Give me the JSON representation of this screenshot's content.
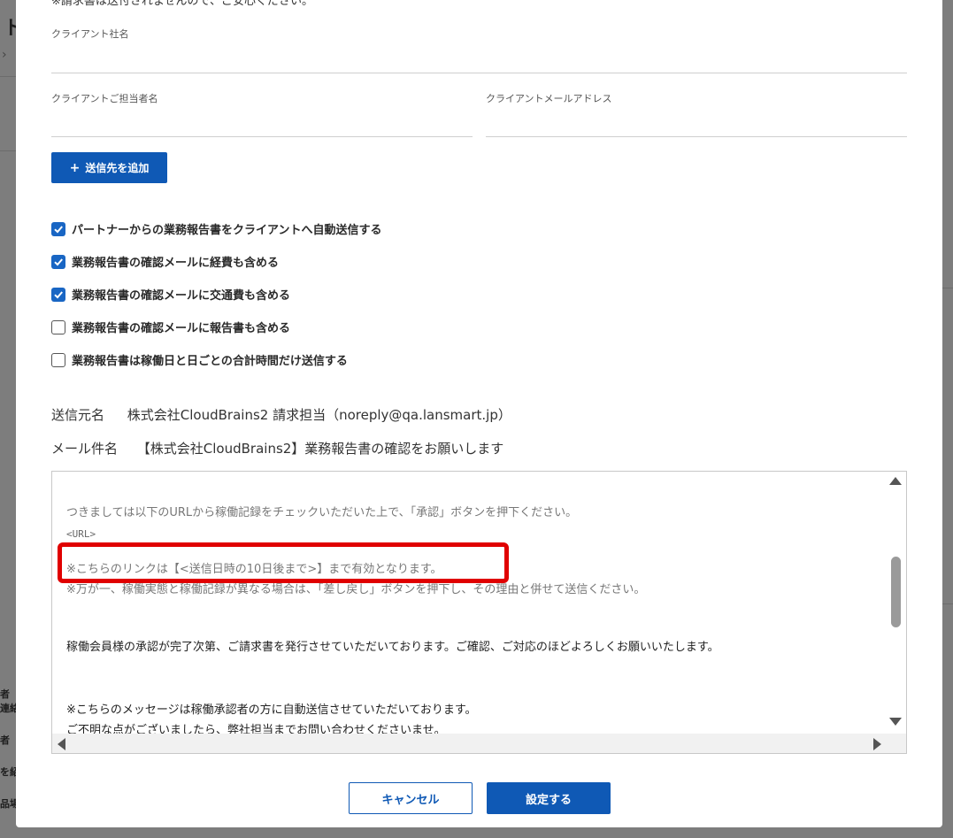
{
  "background": {
    "title_fragment": "ト",
    "side_labels": [
      "者",
      "連絡",
      "者",
      "を紹",
      "品場"
    ]
  },
  "modal": {
    "notice": "※請求書は送付されませんので、ご安心ください。",
    "fields": {
      "client_company_label": "クライアント社名",
      "client_contact_label": "クライアントご担当者名",
      "client_email_label": "クライアントメールアドレス"
    },
    "add_recipient_label": "送信先を追加",
    "checkboxes": [
      {
        "label": "パートナーからの業務報告書をクライアントへ自動送信する",
        "checked": true
      },
      {
        "label": "業務報告書の確認メールに経費も含める",
        "checked": true
      },
      {
        "label": "業務報告書の確認メールに交通費も含める",
        "checked": true
      },
      {
        "label": "業務報告書の確認メールに報告書も含める",
        "checked": false
      },
      {
        "label": "業務報告書は稼働日と日ごとの合計時間だけ送信する",
        "checked": false
      }
    ],
    "sender_key": "送信元名",
    "sender_value": "株式会社CloudBrains2 請求担当（noreply@qa.lansmart.jp）",
    "subject_key": "メール件名",
    "subject_value": "【株式会社CloudBrains2】業務報告書の確認をお願いします",
    "mail_lines": {
      "line1": "つきましては以下のURLから稼働記録をチェックいただいた上で、「承認」ボタンを押下ください。",
      "line2": "<URL>",
      "line3": "※こちらのリンクは【<送信日時の10日後まで>】まで有効となります。",
      "line4": "※万が一、稼働実態と稼働記録が異なる場合は、「差し戻し」ボタンを押下し、その理由と併せて送信ください。",
      "line5": "稼働会員様の承認が完了次第、ご請求書を発行させていただいております。ご確認、ご対応のほどよろしくお願いいたします。",
      "line6": "※こちらのメッセージは稼働承認者の方に自動送信させていただいております。",
      "line7": "ご不明な点がございましたら、弊社担当までお問い合わせくださいませ。"
    },
    "cancel_label": "キャンセル",
    "save_label": "設定する"
  },
  "colors": {
    "primary": "#0f59b5",
    "highlight": "#e00000"
  }
}
